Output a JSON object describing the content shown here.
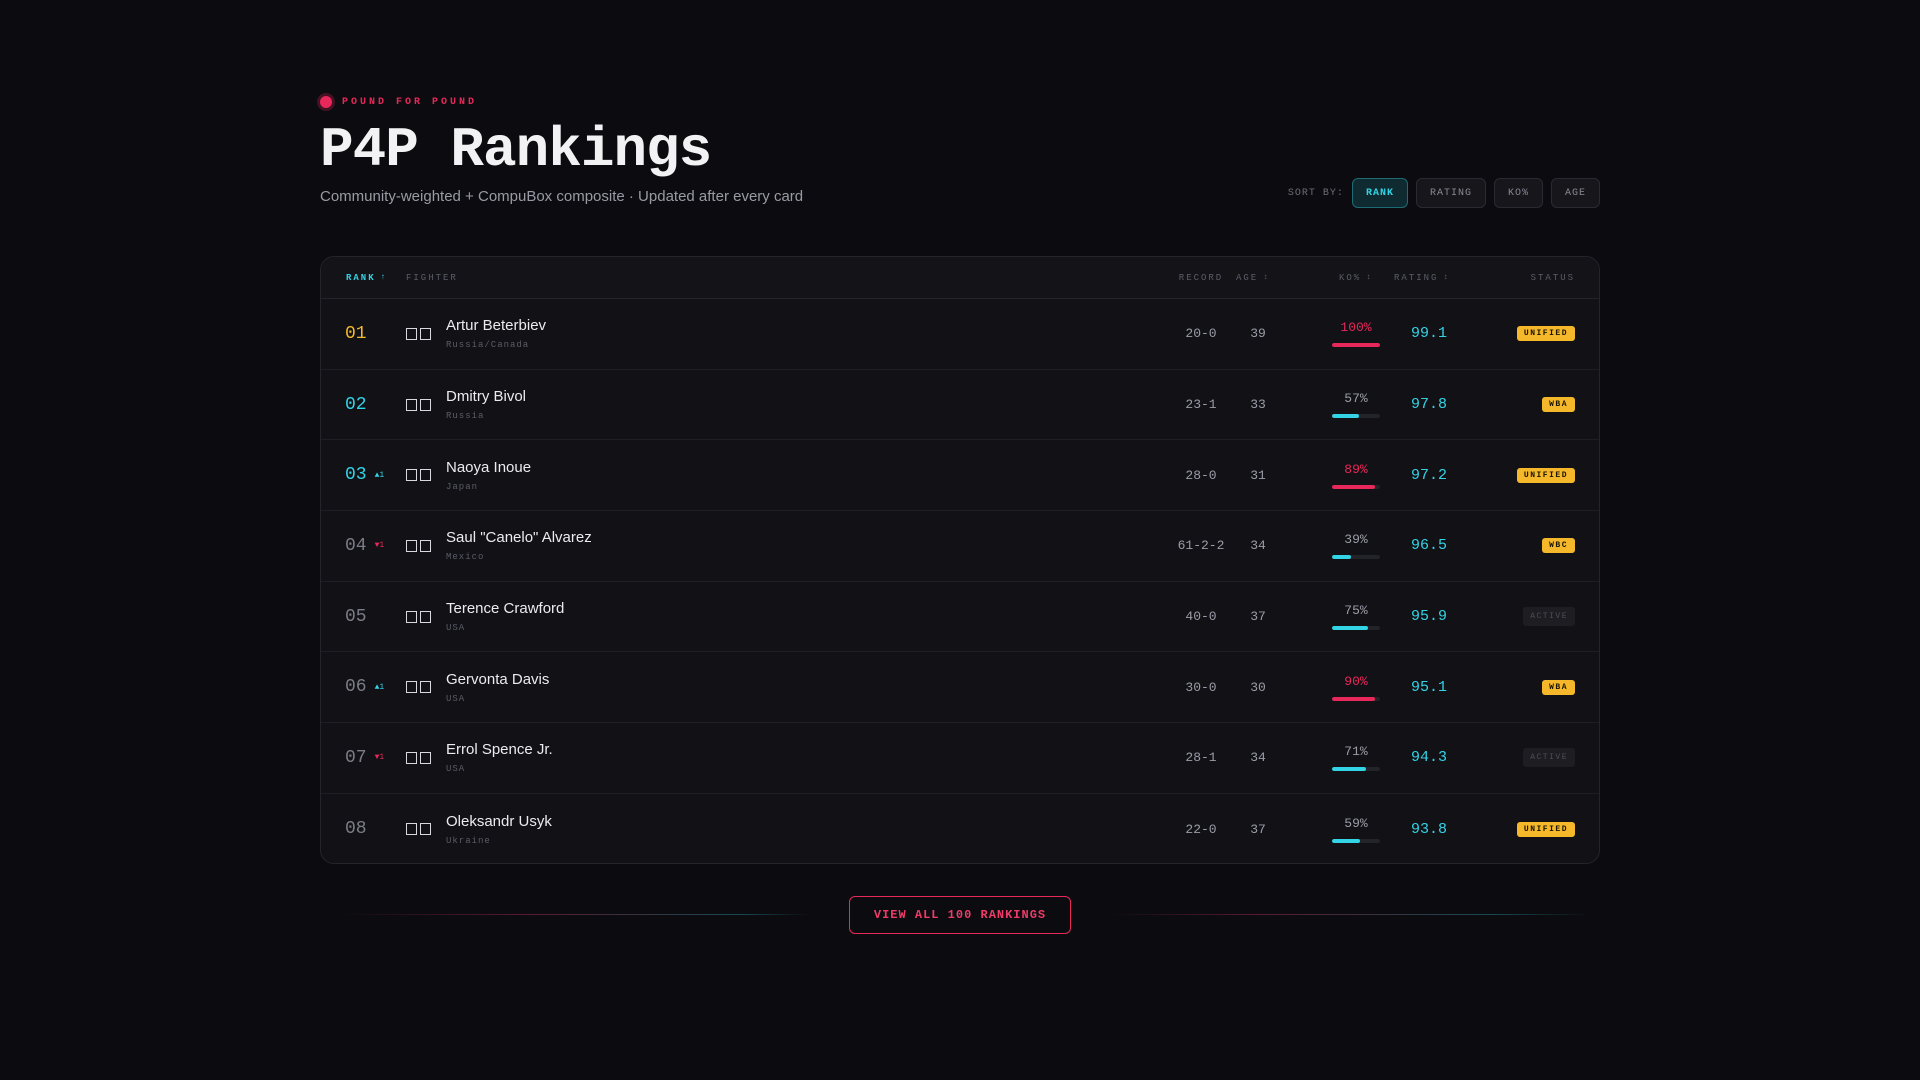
{
  "header": {
    "eyebrow": "POUND FOR POUND",
    "title": "P4P Rankings",
    "subtitle": "Community-weighted + CompuBox composite · Updated after every card"
  },
  "sort": {
    "label": "SORT BY:",
    "options": [
      "RANK",
      "RATING",
      "KO%",
      "AGE"
    ],
    "active": "RANK"
  },
  "table": {
    "columns": {
      "rank": "RANK",
      "fighter": "FIGHTER",
      "record": "RECORD",
      "age": "AGE",
      "ko": "KO%",
      "rating": "RATING",
      "status": "STATUS"
    },
    "rows": [
      {
        "rank": "01",
        "move": "",
        "name": "Artur Beterbiev",
        "country": "Russia/Canada",
        "record": "20-0",
        "age": "39",
        "ko": "100%",
        "ko_value": 1.0,
        "ko_hot": true,
        "rating": "99.1",
        "status": "UNIFIED",
        "status_muted": false
      },
      {
        "rank": "02",
        "move": "",
        "name": "Dmitry Bivol",
        "country": "Russia",
        "record": "23-1",
        "age": "33",
        "ko": "57%",
        "ko_value": 0.57,
        "ko_hot": false,
        "rating": "97.8",
        "status": "WBA",
        "status_muted": false
      },
      {
        "rank": "03",
        "move": "▲1",
        "name": "Naoya Inoue",
        "country": "Japan",
        "record": "28-0",
        "age": "31",
        "ko": "89%",
        "ko_value": 0.89,
        "ko_hot": true,
        "rating": "97.2",
        "status": "UNIFIED",
        "status_muted": false
      },
      {
        "rank": "04",
        "move": "▼1",
        "name": "Saul \"Canelo\" Alvarez",
        "country": "Mexico",
        "record": "61-2-2",
        "age": "34",
        "ko": "39%",
        "ko_value": 0.39,
        "ko_hot": false,
        "rating": "96.5",
        "status": "WBC",
        "status_muted": false
      },
      {
        "rank": "05",
        "move": "",
        "name": "Terence Crawford",
        "country": "USA",
        "record": "40-0",
        "age": "37",
        "ko": "75%",
        "ko_value": 0.75,
        "ko_hot": false,
        "rating": "95.9",
        "status": "ACTIVE",
        "status_muted": true
      },
      {
        "rank": "06",
        "move": "▲1",
        "name": "Gervonta Davis",
        "country": "USA",
        "record": "30-0",
        "age": "30",
        "ko": "90%",
        "ko_value": 0.9,
        "ko_hot": true,
        "rating": "95.1",
        "status": "WBA",
        "status_muted": false
      },
      {
        "rank": "07",
        "move": "▼1",
        "name": "Errol Spence Jr.",
        "country": "USA",
        "record": "28-1",
        "age": "34",
        "ko": "71%",
        "ko_value": 0.71,
        "ko_hot": false,
        "rating": "94.3",
        "status": "ACTIVE",
        "status_muted": true
      },
      {
        "rank": "08",
        "move": "",
        "name": "Oleksandr Usyk",
        "country": "Ukraine",
        "record": "22-0",
        "age": "37",
        "ko": "59%",
        "ko_value": 0.59,
        "ko_hot": false,
        "rating": "93.8",
        "status": "UNIFIED",
        "status_muted": false
      }
    ]
  },
  "footer": {
    "view_all": "VIEW ALL 100 RANKINGS"
  },
  "colors": {
    "accent": "#e8285a",
    "cyan": "#33d4e6",
    "gold": "#f5b82a",
    "background": "#0c0c10"
  }
}
